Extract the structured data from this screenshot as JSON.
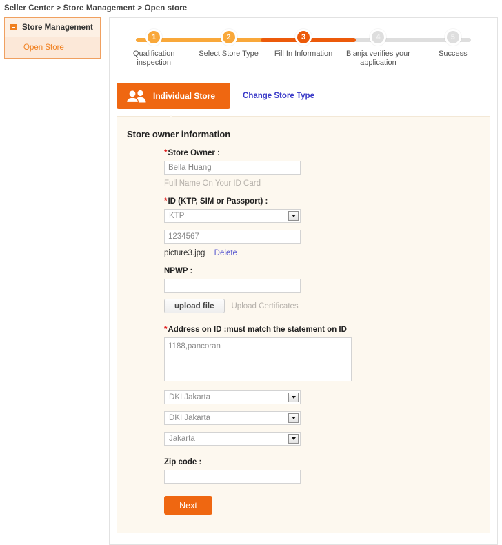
{
  "breadcrumb": "Seller Center > Store Management > Open store",
  "sidebar": {
    "header": "Store Management",
    "toggle_icon": "minus-square-icon",
    "items": [
      {
        "label": "Open Store"
      }
    ]
  },
  "stepper": {
    "steps": [
      {
        "num": "1",
        "label": "Qualification inspection",
        "state": "done"
      },
      {
        "num": "2",
        "label": "Select Store Type",
        "state": "done"
      },
      {
        "num": "3",
        "label": "Fill In Information",
        "state": "active"
      },
      {
        "num": "4",
        "label": "Blanja verifies your application",
        "state": "todo"
      },
      {
        "num": "5",
        "label": "Success",
        "state": "todo"
      }
    ],
    "colors": {
      "done": "#f9a83a",
      "active": "#ec5a0a",
      "todo": "#dedede"
    }
  },
  "store_type": {
    "tab_label": "Individual Store",
    "tab_icon": "people-icon",
    "change_link": "Change Store Type"
  },
  "form": {
    "title": "Store owner information",
    "store_owner": {
      "label": "Store Owner :",
      "required_mark": "*",
      "value": "Bella Huang",
      "hint": "Full Name On Your ID Card"
    },
    "id_type": {
      "label": "ID (KTP, SIM or Passport) :",
      "required_mark": "*",
      "selected": "KTP"
    },
    "id_number": {
      "value": "1234567"
    },
    "id_file": {
      "name": "picture3.jpg",
      "delete_label": "Delete"
    },
    "npwp": {
      "label": "NPWP :",
      "value": ""
    },
    "upload": {
      "button_label": "upload file",
      "hint": "Upload Certificates"
    },
    "address": {
      "label": "Address on ID :must match the statement on ID",
      "required_mark": "*",
      "value": "1188,pancoran"
    },
    "province": {
      "selected": "DKI Jakarta"
    },
    "city": {
      "selected": "DKI Jakarta"
    },
    "district": {
      "selected": "Jakarta"
    },
    "zip": {
      "label": "Zip code :",
      "value": ""
    },
    "submit_label": "Next"
  },
  "accent": {
    "orange": "#ef6711",
    "amber": "#f9a83a",
    "link_blue": "#3a3ac8",
    "card_bg": "#fdf8ef"
  }
}
